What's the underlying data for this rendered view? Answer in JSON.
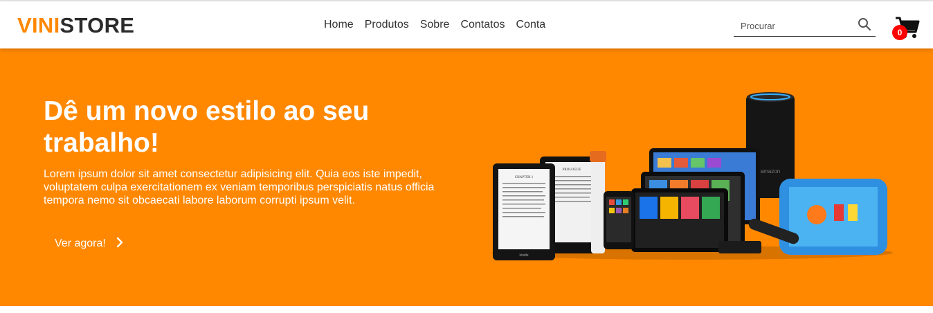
{
  "brand": {
    "part1": "VINI",
    "part2": "STORE"
  },
  "nav": {
    "items": [
      {
        "label": "Home"
      },
      {
        "label": "Produtos"
      },
      {
        "label": "Sobre"
      },
      {
        "label": "Contatos"
      },
      {
        "label": "Conta"
      }
    ]
  },
  "search": {
    "placeholder": "Procurar",
    "value": "",
    "icon": "search-icon"
  },
  "cart": {
    "icon": "shopping-cart-icon",
    "count": "0"
  },
  "hero": {
    "title": "Dê um novo estilo ao seu trabalho!",
    "description": "Lorem ipsum dolor sit amet consectetur adipisicing elit. Quia eos iste impedit, voluptatem culpa exercitationem ex veniam temporibus perspiciatis natus officia tempora nemo sit obcaecati labore laborum corrupti ipsum velit.",
    "cta_label": "Ver agora!",
    "cta_icon": "chevron-right-icon",
    "ereader_1_text": "CHAPTER 1",
    "ereader_2_text": "PROLOGUE",
    "ereader_brand": "kindle",
    "speaker_brand": "amazon"
  },
  "colors": {
    "accent": "#ff8800",
    "dark_text": "#2b2b2b",
    "badge": "#ff0000",
    "hero_text": "#ffffff"
  }
}
